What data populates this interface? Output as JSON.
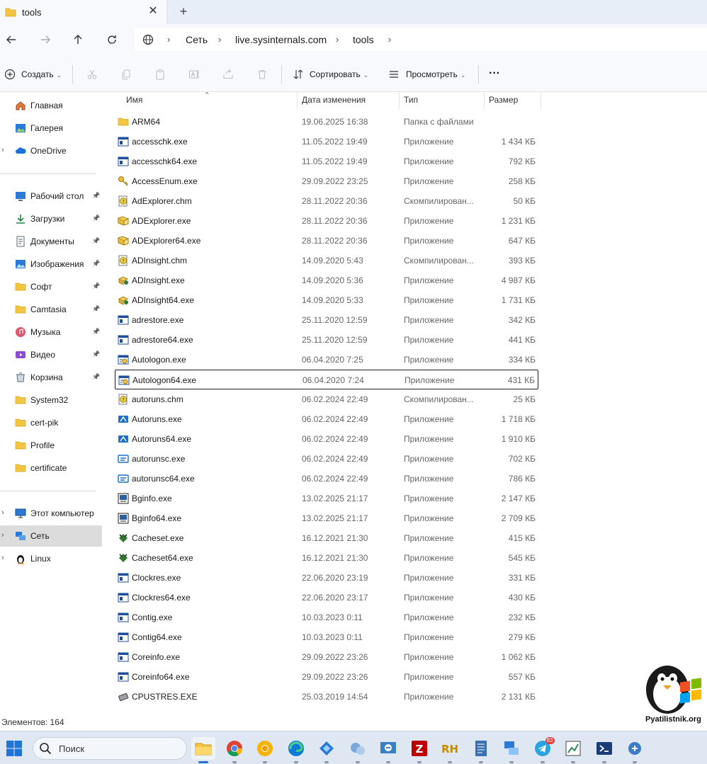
{
  "window": {
    "tab_title": "tools",
    "tab_close": "✕",
    "new_tab": "+"
  },
  "address": {
    "segments": [
      "Сеть",
      "live.sysinternals.com",
      "tools"
    ]
  },
  "toolbar": {
    "new_label": "Создать",
    "sort_label": "Сортировать",
    "view_label": "Просмотреть",
    "more_label": "···"
  },
  "sidebar": {
    "top_items": [
      {
        "label": "Главная",
        "icon": "home-icon"
      },
      {
        "label": "Галерея",
        "icon": "gallery-icon"
      },
      {
        "label": "OneDrive",
        "icon": "onedrive-icon"
      }
    ],
    "quick_access": [
      {
        "label": "Рабочий стол",
        "icon": "desktop-icon",
        "pinned": true
      },
      {
        "label": "Загрузки",
        "icon": "downloads-icon",
        "pinned": true
      },
      {
        "label": "Документы",
        "icon": "documents-icon",
        "pinned": true
      },
      {
        "label": "Изображения",
        "icon": "pictures-icon",
        "pinned": true
      },
      {
        "label": "Софт",
        "icon": "folder-icon",
        "pinned": true
      },
      {
        "label": "Camtasia",
        "icon": "folder-icon",
        "pinned": true
      },
      {
        "label": "Музыка",
        "icon": "music-icon",
        "pinned": true
      },
      {
        "label": "Видео",
        "icon": "video-icon",
        "pinned": true
      },
      {
        "label": "Корзина",
        "icon": "recycle-bin-icon",
        "pinned": true
      },
      {
        "label": "System32",
        "icon": "folder-icon",
        "pinned": false
      },
      {
        "label": "cert-pik",
        "icon": "folder-icon",
        "pinned": false
      },
      {
        "label": "Profile",
        "icon": "folder-icon",
        "pinned": false
      },
      {
        "label": "certificate",
        "icon": "folder-icon",
        "pinned": false
      }
    ],
    "bottom_items": [
      {
        "label": "Этот компьютер",
        "icon": "computer-icon"
      },
      {
        "label": "Сеть",
        "icon": "network-icon"
      },
      {
        "label": "Linux",
        "icon": "linux-icon"
      }
    ]
  },
  "columns": {
    "name": "Имя",
    "date": "Дата изменения",
    "type": "Тип",
    "size": "Размер"
  },
  "files": [
    {
      "name": "ARM64",
      "date": "19.06.2025 16:38",
      "type": "Папка с файлами",
      "size": "",
      "icon": "folder"
    },
    {
      "name": "accesschk.exe",
      "date": "11.05.2022 19:49",
      "type": "Приложение",
      "size": "1 434 КБ",
      "icon": "app"
    },
    {
      "name": "accesschk64.exe",
      "date": "11.05.2022 19:49",
      "type": "Приложение",
      "size": "792 КБ",
      "icon": "app"
    },
    {
      "name": "AccessEnum.exe",
      "date": "29.09.2022 23:25",
      "type": "Приложение",
      "size": "258 КБ",
      "icon": "key"
    },
    {
      "name": "AdExplorer.chm",
      "date": "28.11.2022 20:36",
      "type": "Скомпилирован...",
      "size": "50 КБ",
      "icon": "chm"
    },
    {
      "name": "ADExplorer.exe",
      "date": "28.11.2022 20:36",
      "type": "Приложение",
      "size": "1 231 КБ",
      "icon": "book"
    },
    {
      "name": "ADExplorer64.exe",
      "date": "28.11.2022 20:36",
      "type": "Приложение",
      "size": "647 КБ",
      "icon": "book"
    },
    {
      "name": "ADInsight.chm",
      "date": "14.09.2020 5:43",
      "type": "Скомпилирован...",
      "size": "393 КБ",
      "icon": "chm"
    },
    {
      "name": "ADInsight.exe",
      "date": "14.09.2020 5:36",
      "type": "Приложение",
      "size": "4 987 КБ",
      "icon": "insight"
    },
    {
      "name": "ADInsight64.exe",
      "date": "14.09.2020 5:33",
      "type": "Приложение",
      "size": "1 731 КБ",
      "icon": "insight"
    },
    {
      "name": "adrestore.exe",
      "date": "25.11.2020 12:59",
      "type": "Приложение",
      "size": "342 КБ",
      "icon": "app"
    },
    {
      "name": "adrestore64.exe",
      "date": "25.11.2020 12:59",
      "type": "Приложение",
      "size": "441 КБ",
      "icon": "app"
    },
    {
      "name": "Autologon.exe",
      "date": "06.04.2020 7:25",
      "type": "Приложение",
      "size": "334 КБ",
      "icon": "autologon"
    },
    {
      "name": "Autologon64.exe",
      "date": "06.04.2020 7:24",
      "type": "Приложение",
      "size": "431 КБ",
      "icon": "autologon",
      "focused": true
    },
    {
      "name": "autoruns.chm",
      "date": "06.02.2024 22:49",
      "type": "Скомпилирован...",
      "size": "25 КБ",
      "icon": "chm"
    },
    {
      "name": "Autoruns.exe",
      "date": "06.02.2024 22:49",
      "type": "Приложение",
      "size": "1 718 КБ",
      "icon": "autoruns"
    },
    {
      "name": "Autoruns64.exe",
      "date": "06.02.2024 22:49",
      "type": "Приложение",
      "size": "1 910 КБ",
      "icon": "autoruns"
    },
    {
      "name": "autorunsc.exe",
      "date": "06.02.2024 22:49",
      "type": "Приложение",
      "size": "702 КБ",
      "icon": "autorunsc"
    },
    {
      "name": "autorunsc64.exe",
      "date": "06.02.2024 22:49",
      "type": "Приложение",
      "size": "786 КБ",
      "icon": "autorunsc"
    },
    {
      "name": "Bginfo.exe",
      "date": "13.02.2025 21:17",
      "type": "Приложение",
      "size": "2 147 КБ",
      "icon": "bginfo"
    },
    {
      "name": "Bginfo64.exe",
      "date": "13.02.2025 21:17",
      "type": "Приложение",
      "size": "2 709 КБ",
      "icon": "bginfo"
    },
    {
      "name": "Cacheset.exe",
      "date": "16.12.2021 21:30",
      "type": "Приложение",
      "size": "415 КБ",
      "icon": "cacheset"
    },
    {
      "name": "Cacheset64.exe",
      "date": "16.12.2021 21:30",
      "type": "Приложение",
      "size": "545 КБ",
      "icon": "cacheset"
    },
    {
      "name": "Clockres.exe",
      "date": "22.06.2020 23:19",
      "type": "Приложение",
      "size": "331 КБ",
      "icon": "app"
    },
    {
      "name": "Clockres64.exe",
      "date": "22.06.2020 23:17",
      "type": "Приложение",
      "size": "430 КБ",
      "icon": "app"
    },
    {
      "name": "Contig.exe",
      "date": "10.03.2023 0:11",
      "type": "Приложение",
      "size": "232 КБ",
      "icon": "app"
    },
    {
      "name": "Contig64.exe",
      "date": "10.03.2023 0:11",
      "type": "Приложение",
      "size": "279 КБ",
      "icon": "app"
    },
    {
      "name": "Coreinfo.exe",
      "date": "29.09.2022 23:26",
      "type": "Приложение",
      "size": "1 062 КБ",
      "icon": "app"
    },
    {
      "name": "Coreinfo64.exe",
      "date": "29.09.2022 23:26",
      "type": "Приложение",
      "size": "557 КБ",
      "icon": "app"
    },
    {
      "name": "CPUSTRES.EXE",
      "date": "25.03.2019 14:54",
      "type": "Приложение",
      "size": "2 131 КБ",
      "icon": "cpustres"
    }
  ],
  "status": {
    "items_count": "Элементов: 164"
  },
  "watermark": {
    "text": "Pyatilistnik.org"
  },
  "taskbar": {
    "search_placeholder": "Поиск",
    "apps": [
      {
        "name": "file-explorer-icon",
        "active": true
      },
      {
        "name": "chrome-icon",
        "active": false
      },
      {
        "name": "chrome-canary-icon",
        "active": false
      },
      {
        "name": "edge-icon",
        "active": false
      },
      {
        "name": "network-tool-icon",
        "active": false
      },
      {
        "name": "system-tool-icon",
        "active": false
      },
      {
        "name": "rdp-manager-icon",
        "active": false
      },
      {
        "name": "filezilla-icon",
        "active": false
      },
      {
        "name": "rh-icon",
        "active": false
      },
      {
        "name": "notes-icon",
        "active": false
      },
      {
        "name": "network-admin-icon",
        "active": false
      },
      {
        "name": "telegram-icon",
        "active": false,
        "badge": "83"
      },
      {
        "name": "paint-icon",
        "active": false
      },
      {
        "name": "powershell-icon",
        "active": false
      },
      {
        "name": "remote-tools-icon",
        "active": false
      }
    ]
  },
  "colors": {
    "folder": "#f4c542",
    "accent": "#2b6fcc",
    "selected": "#dcdcdc"
  }
}
